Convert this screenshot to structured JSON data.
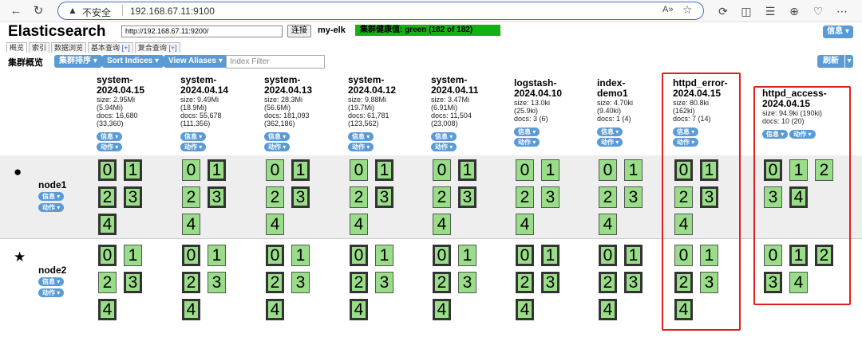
{
  "browser": {
    "security_label": "不安全",
    "url": "192.168.67.11:9100"
  },
  "header": {
    "title": "Elasticsearch",
    "connect_url": "http://192.168.67.11:9200/",
    "connect_label": "连接",
    "cluster_name": "my-elk",
    "health": "集群健康值: green (182 of 182)",
    "info_label": "信息 ▾"
  },
  "tabs": [
    {
      "label": "概览",
      "plus": ""
    },
    {
      "label": "索引",
      "plus": ""
    },
    {
      "label": "数据浏览",
      "plus": ""
    },
    {
      "label": "基本查询 ",
      "plus": "[+]"
    },
    {
      "label": "复合查询 ",
      "plus": "[+]"
    }
  ],
  "toolbar": {
    "label": "集群概览",
    "sort_cluster": "集群排序 ▾",
    "sort_indices": "Sort Indices ▾",
    "view_aliases": "View Aliases ▾",
    "filter_placeholder": "Index Filter",
    "refresh": "刷新",
    "refresh_caret": "▾"
  },
  "colors": {
    "accent": "#5b9bd5",
    "shard": "#99dd88",
    "health": "#14b014",
    "highlight": "#e02020"
  },
  "indices": [
    {
      "name1": "system-",
      "name2": "2024.04.15",
      "size": "size: 2.95Mi",
      "size2": "(5.94Mi)",
      "docs": "docs: 16,680",
      "docs2": "(33,360)",
      "info": "信息 ▾",
      "action": "动作 ▾",
      "shards_node1": [
        "0",
        "1",
        "2",
        "3",
        "4"
      ],
      "primary_node1": [
        true,
        true,
        true,
        true,
        true
      ],
      "shards_node2": [
        "0",
        "1",
        "2",
        "3",
        "4"
      ],
      "primary_node2": [
        true,
        false,
        false,
        true,
        true
      ]
    },
    {
      "name1": "system-",
      "name2": "2024.04.14",
      "size": "size: 9.49Mi",
      "size2": "(18.9Mi)",
      "docs": "docs: 55,678",
      "docs2": "(111,356)",
      "info": "信息 ▾",
      "action": "动作 ▾",
      "shards_node1": [
        "0",
        "1",
        "2",
        "3",
        "4"
      ],
      "primary_node1": [
        false,
        true,
        false,
        true,
        false
      ],
      "shards_node2": [
        "0",
        "1",
        "2",
        "3",
        "4"
      ],
      "primary_node2": [
        true,
        false,
        true,
        false,
        true
      ]
    },
    {
      "name1": "system-",
      "name2": "2024.04.13",
      "size": "size: 28.3Mi",
      "size2": "(56.6Mi)",
      "docs": "docs: 181,093",
      "docs2": "(362,186)",
      "info": "信息 ▾",
      "action": "动作 ▾",
      "shards_node1": [
        "0",
        "1",
        "2",
        "3",
        "4"
      ],
      "primary_node1": [
        false,
        true,
        false,
        true,
        false
      ],
      "shards_node2": [
        "0",
        "1",
        "2",
        "3",
        "4"
      ],
      "primary_node2": [
        true,
        false,
        true,
        false,
        true
      ]
    },
    {
      "name1": "system-",
      "name2": "2024.04.12",
      "size": "size: 9.88Mi",
      "size2": "(19.7Mi)",
      "docs": "docs: 61,781",
      "docs2": "(123,562)",
      "info": "信息 ▾",
      "action": "动作 ▾",
      "shards_node1": [
        "0",
        "1",
        "2",
        "3",
        "4"
      ],
      "primary_node1": [
        false,
        true,
        false,
        true,
        false
      ],
      "shards_node2": [
        "0",
        "1",
        "2",
        "3",
        "4"
      ],
      "primary_node2": [
        true,
        false,
        true,
        false,
        true
      ]
    },
    {
      "name1": "system-",
      "name2": "2024.04.11",
      "size": "size: 3.47Mi",
      "size2": "(6.91Mi)",
      "docs": "docs: 11,504",
      "docs2": "(23,008)",
      "info": "信息 ▾",
      "action": "动作 ▾",
      "shards_node1": [
        "0",
        "1",
        "2",
        "3",
        "4"
      ],
      "primary_node1": [
        false,
        true,
        false,
        true,
        false
      ],
      "shards_node2": [
        "0",
        "1",
        "2",
        "3",
        "4"
      ],
      "primary_node2": [
        true,
        false,
        true,
        false,
        true
      ]
    },
    {
      "name1": "logstash-",
      "name2": "2024.04.10",
      "size": "size: 13.0ki",
      "size2": "(25.9ki)",
      "docs": "docs: 3 (6)",
      "docs2": "",
      "info": "信息 ▾",
      "action": "动作 ▾",
      "shards_node1": [
        "0",
        "1",
        "2",
        "3",
        "4"
      ],
      "primary_node1": [
        false,
        false,
        false,
        false,
        false
      ],
      "shards_node2": [
        "0",
        "1",
        "2",
        "3",
        "4"
      ],
      "primary_node2": [
        true,
        true,
        true,
        true,
        true
      ]
    },
    {
      "name1": "index-",
      "name2": "demo1",
      "size": "size: 4.70ki",
      "size2": "(9.40ki)",
      "docs": "docs: 1 (4)",
      "docs2": "",
      "info": "信息 ▾",
      "action": "动作 ▾",
      "shards_node1": [
        "0",
        "1",
        "2",
        "3",
        "4"
      ],
      "primary_node1": [
        false,
        false,
        false,
        false,
        false
      ],
      "shards_node2": [
        "0",
        "1",
        "2",
        "3",
        "4"
      ],
      "primary_node2": [
        true,
        true,
        true,
        true,
        true
      ]
    },
    {
      "name1": "httpd_error-",
      "name2": "2024.04.15",
      "size": "size: 80.8ki",
      "size2": "(162ki)",
      "docs": "docs: 7 (14)",
      "docs2": "",
      "info": "信息 ▾",
      "action": "动作 ▾",
      "shards_node1": [
        "0",
        "1",
        "2",
        "3",
        "4"
      ],
      "primary_node1": [
        true,
        true,
        false,
        true,
        false
      ],
      "shards_node2": [
        "0",
        "1",
        "2",
        "3",
        "4"
      ],
      "primary_node2": [
        false,
        false,
        true,
        false,
        true
      ]
    },
    {
      "name1": "httpd_access-",
      "name2": "2024.04.15",
      "size": "size: 94.9ki (190ki)",
      "size2": "",
      "docs": "docs: 10 (20)",
      "docs2": "",
      "info": "信息 ▾",
      "action": "动作 ▾",
      "shards_node1": [
        "0",
        "1",
        "2",
        "3",
        "4"
      ],
      "primary_node1": [
        true,
        false,
        false,
        false,
        true
      ],
      "shards_node2": [
        "0",
        "1",
        "2",
        "3",
        "4"
      ],
      "primary_node2": [
        false,
        true,
        true,
        true,
        false
      ]
    }
  ],
  "nodes": [
    {
      "name": "node1",
      "icon": "●",
      "info": "信息 ▾",
      "action": "动作 ▾"
    },
    {
      "name": "node2",
      "icon": "★",
      "info": "信息 ▾",
      "action": "动作 ▾"
    }
  ]
}
